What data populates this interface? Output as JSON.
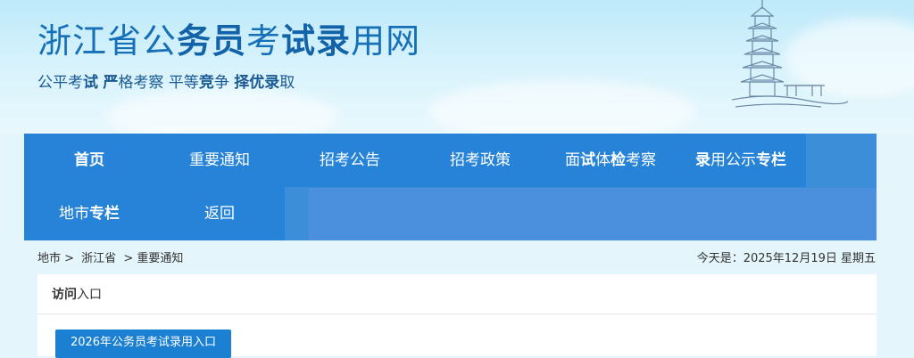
{
  "header": {
    "title_parts": [
      "浙江省公",
      "务员",
      "考",
      "试录",
      "用网"
    ],
    "slogan_parts": [
      "公平考",
      "试",
      " ",
      "严",
      "格考察 平等",
      "竞",
      "争 ",
      "择优录",
      "取"
    ]
  },
  "nav": {
    "items": [
      {
        "label": "首页"
      },
      {
        "label": "重要通知"
      },
      {
        "label": "招考公告"
      },
      {
        "label": "招考政策"
      },
      {
        "label_parts": [
          "面",
          "试",
          "体",
          "检",
          "考察"
        ]
      },
      {
        "label_parts": [
          "录",
          "用公示",
          "专栏"
        ]
      },
      {
        "label_parts": [
          "地市",
          "专栏"
        ]
      },
      {
        "label": "返回"
      }
    ]
  },
  "breadcrumb": [
    "地市 >",
    "浙江省",
    " > 重要通知"
  ],
  "date_text": "今天是：2025年12月19日 星期五",
  "panel": {
    "title_parts": [
      "访问",
      "入口"
    ],
    "button_label": "2026年公务员考试录用入口"
  },
  "colors": {
    "nav_bg": "#2683d7",
    "title_blue": "#1670b8",
    "button_blue": "#1b7fd2"
  }
}
